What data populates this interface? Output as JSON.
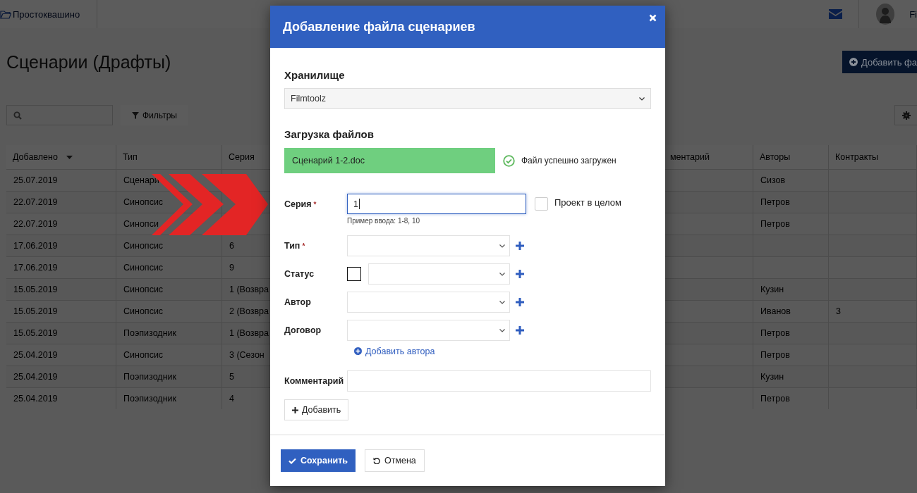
{
  "top_bar": {
    "project": "Простоквашино",
    "user": "Fi"
  },
  "page": {
    "title": "Сценарии (Драфты)",
    "add_button": "Добавить фа",
    "filter_button": "Фильтры"
  },
  "table": {
    "columns": [
      {
        "label": "Добавлено",
        "sorted": true
      },
      {
        "label": "Тип",
        "sorted": false
      },
      {
        "label": "Серия",
        "sorted": false
      },
      {
        "label": "ментарий",
        "sorted": false
      },
      {
        "label": "Авторы",
        "sorted": false
      },
      {
        "label": "Контракты",
        "sorted": false
      }
    ],
    "rows": [
      {
        "added": "25.07.2019",
        "type": "Сценари",
        "authors": "Сизов"
      },
      {
        "added": "22.07.2019",
        "type": "Синопсис",
        "authors": "Петров"
      },
      {
        "added": "22.07.2019",
        "type": "Синопси",
        "authors": "Петров"
      },
      {
        "added": "17.06.2019",
        "type": "Синопсис",
        "series": "6"
      },
      {
        "added": "17.06.2019",
        "type": "Синопсис",
        "series": "9"
      },
      {
        "added": "15.05.2019",
        "type": "Синопсис",
        "series": "1 (Возвра",
        "authors": "Кузин"
      },
      {
        "added": "15.05.2019",
        "type": "Синопсис",
        "series": "2 (Возвра",
        "authors": "Иванов",
        "contracts": "3"
      },
      {
        "added": "15.05.2019",
        "type": "Поэпизодник",
        "series": "1 (Возвра",
        "authors": "Петров"
      },
      {
        "added": "25.04.2019",
        "type": "Синопсис",
        "series": "3 (Сезон",
        "authors": "Петров"
      },
      {
        "added": "25.04.2019",
        "type": "Поэпизодник",
        "series": "5",
        "authors": "Кузин"
      },
      {
        "added": "25.04.2019",
        "type": "Поэпизодник",
        "series": "4",
        "authors": "Петров"
      }
    ]
  },
  "modal": {
    "title": "Добавление файла сценариев",
    "storage": {
      "label": "Хранилище",
      "value": "Filmtoolz"
    },
    "upload": {
      "label": "Загрузка файлов",
      "file": "Сценарий 1-2.doc",
      "status": "Файл успешно загружен"
    },
    "fields": [
      {
        "kind": "text",
        "label": "Серия",
        "mark": "*",
        "value": "1",
        "focused": true,
        "hint": "Пример ввода: 1-8, 10",
        "option": {
          "label": "Проект в целом",
          "checked": false
        }
      },
      {
        "kind": "select",
        "label": "Тип",
        "mark": "*"
      },
      {
        "kind": "color_select",
        "label": "Статус"
      },
      {
        "kind": "select",
        "label": "Автор"
      },
      {
        "kind": "select",
        "label": "Договор"
      }
    ],
    "add_author_link": "Добавить автора",
    "comment": {
      "label": "Комментарий"
    },
    "add_button": "Добавить",
    "buttons": [
      {
        "kind": "primary",
        "label": "Сохранить"
      },
      {
        "kind": "cancel",
        "label": "Отмена"
      }
    ]
  }
}
